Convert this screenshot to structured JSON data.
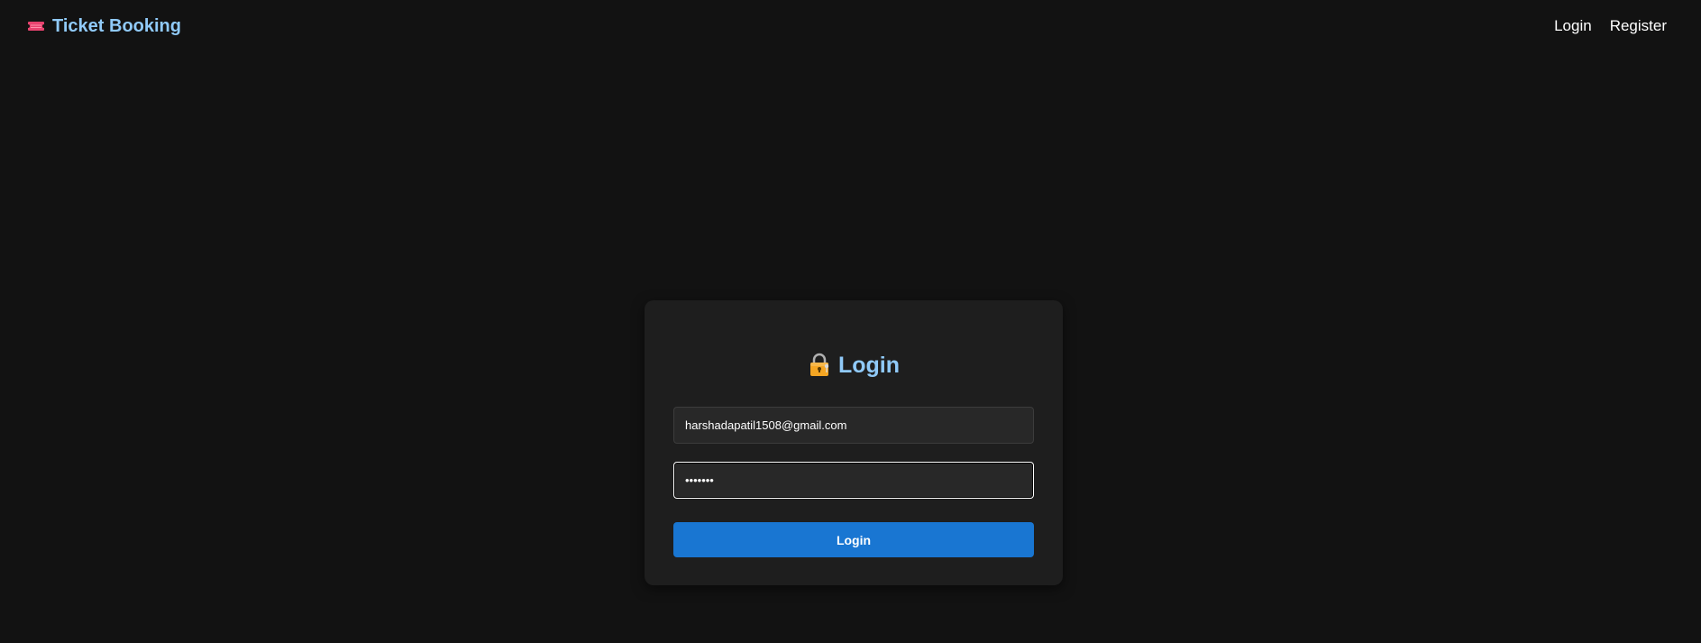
{
  "navbar": {
    "brand_label": "Ticket Booking",
    "brand_icon": "ticket-icon",
    "links": {
      "login": "Login",
      "register": "Register"
    }
  },
  "login_form": {
    "title": "Login",
    "title_icon": "lock-icon",
    "email_value": "harshadapatil1508@gmail.com",
    "password_value": "•••••••",
    "submit_label": "Login"
  },
  "colors": {
    "background": "#121212",
    "card": "#1e1e1e",
    "accent": "#90caf9",
    "button": "#1976d2",
    "ticket_icon": "#e8436f"
  }
}
